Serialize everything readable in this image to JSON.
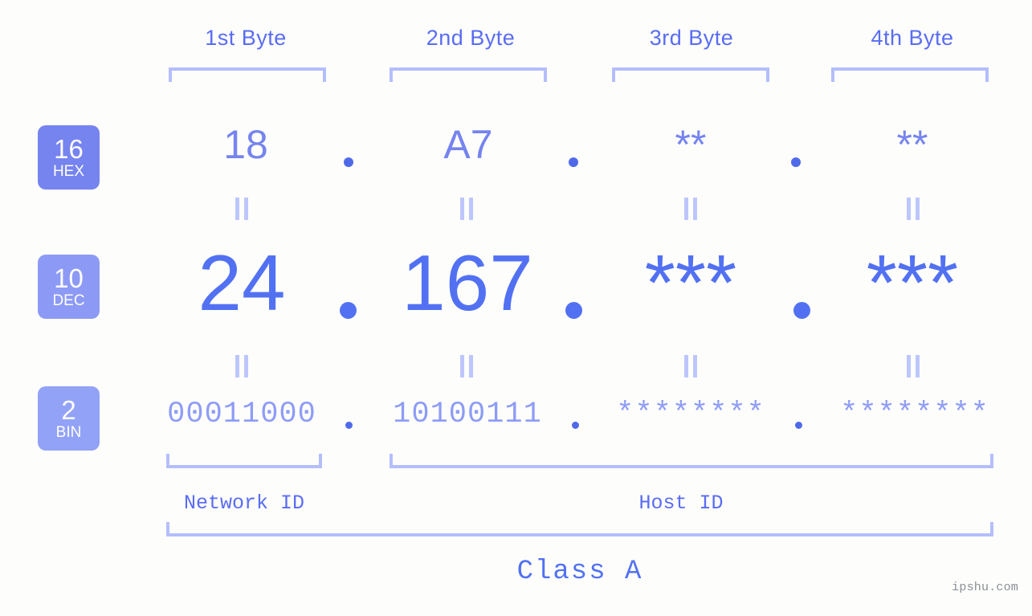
{
  "background_color": "#fdfefb",
  "colors": {
    "header_text": "#5a6cf5",
    "bracket": "#b4befc",
    "hex_value": "#7684ef",
    "dec_value": "#5271f2",
    "bin_value": "#8e9cf7",
    "dot": "#4f6ae9",
    "badge_hex_bg": "#7684ef",
    "badge_dec_bg": "#8d9af5",
    "badge_bin_bg": "#92a2f7",
    "separator": "#bdc6fc",
    "watermark": "#8a8f96"
  },
  "headers": {
    "bytes": [
      {
        "label": "1st Byte"
      },
      {
        "label": "2nd Byte"
      },
      {
        "label": "3rd Byte"
      },
      {
        "label": "4th Byte"
      }
    ]
  },
  "rows": [
    {
      "id": "hex",
      "badge": {
        "number": "16",
        "name": "HEX"
      },
      "values": [
        "18",
        "A7",
        "**",
        "**"
      ],
      "separators": [
        ".",
        ".",
        "."
      ]
    },
    {
      "id": "dec",
      "badge": {
        "number": "10",
        "name": "DEC"
      },
      "values": [
        "24",
        "167",
        "***",
        "***"
      ],
      "separators": [
        ".",
        ".",
        "."
      ]
    },
    {
      "id": "bin",
      "badge": {
        "number": "2",
        "name": "BIN"
      },
      "values": [
        "00011000",
        "10100111",
        "********",
        "********"
      ],
      "separators": [
        ".",
        ".",
        "."
      ]
    }
  ],
  "equals_separator": "||",
  "footer": {
    "network_id_label": "Network ID",
    "host_id_label": "Host ID",
    "class_label": "Class A"
  },
  "watermark": "ipshu.com"
}
